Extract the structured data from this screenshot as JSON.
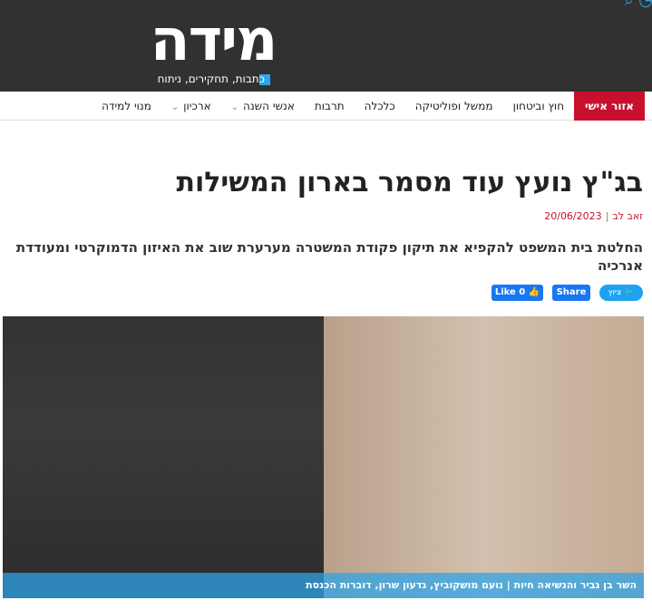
{
  "site": {
    "logo_text": "מידה",
    "tagline": "כתבות, תחקירים, ניתוח"
  },
  "nav": [
    {
      "label": "אזור אישי",
      "highlight": true,
      "dropdown": false
    },
    {
      "label": "חוץ וביטחון",
      "highlight": false,
      "dropdown": false
    },
    {
      "label": "ממשל ופוליטיקה",
      "highlight": false,
      "dropdown": false
    },
    {
      "label": "כלכלה",
      "highlight": false,
      "dropdown": false
    },
    {
      "label": "תרבות",
      "highlight": false,
      "dropdown": false
    },
    {
      "label": "אנשי השנה",
      "highlight": false,
      "dropdown": true
    },
    {
      "label": "ארכיון",
      "highlight": false,
      "dropdown": true
    },
    {
      "label": "מנוי למידה",
      "highlight": false,
      "dropdown": false
    }
  ],
  "article": {
    "title": "בג\"ץ נועץ עוד מסמר בארון המשילות",
    "author": "זאב לב",
    "date": "20/06/2023",
    "subtitle": "החלטת בית המשפט להקפיא את תיקון פקודת המשטרה מערערת שוב את האיזון הדמוקרטי ומעודדת אנרכיה",
    "share": {
      "twitter": "ציוץ",
      "facebook": "Share",
      "like": "Like 0"
    },
    "caption": "השר בן גביר והנשיאה חיות | נועם מושקוביץ, גדעון שרון, דוברות הכנסת"
  },
  "colors": {
    "header": "#313131",
    "accent": "#2fa4e7",
    "highlight": "#c8102e"
  },
  "icons": {
    "twitter": "bird-icon",
    "facebook": "thumbs-up-icon",
    "dropdown": "chevron-down-icon"
  }
}
